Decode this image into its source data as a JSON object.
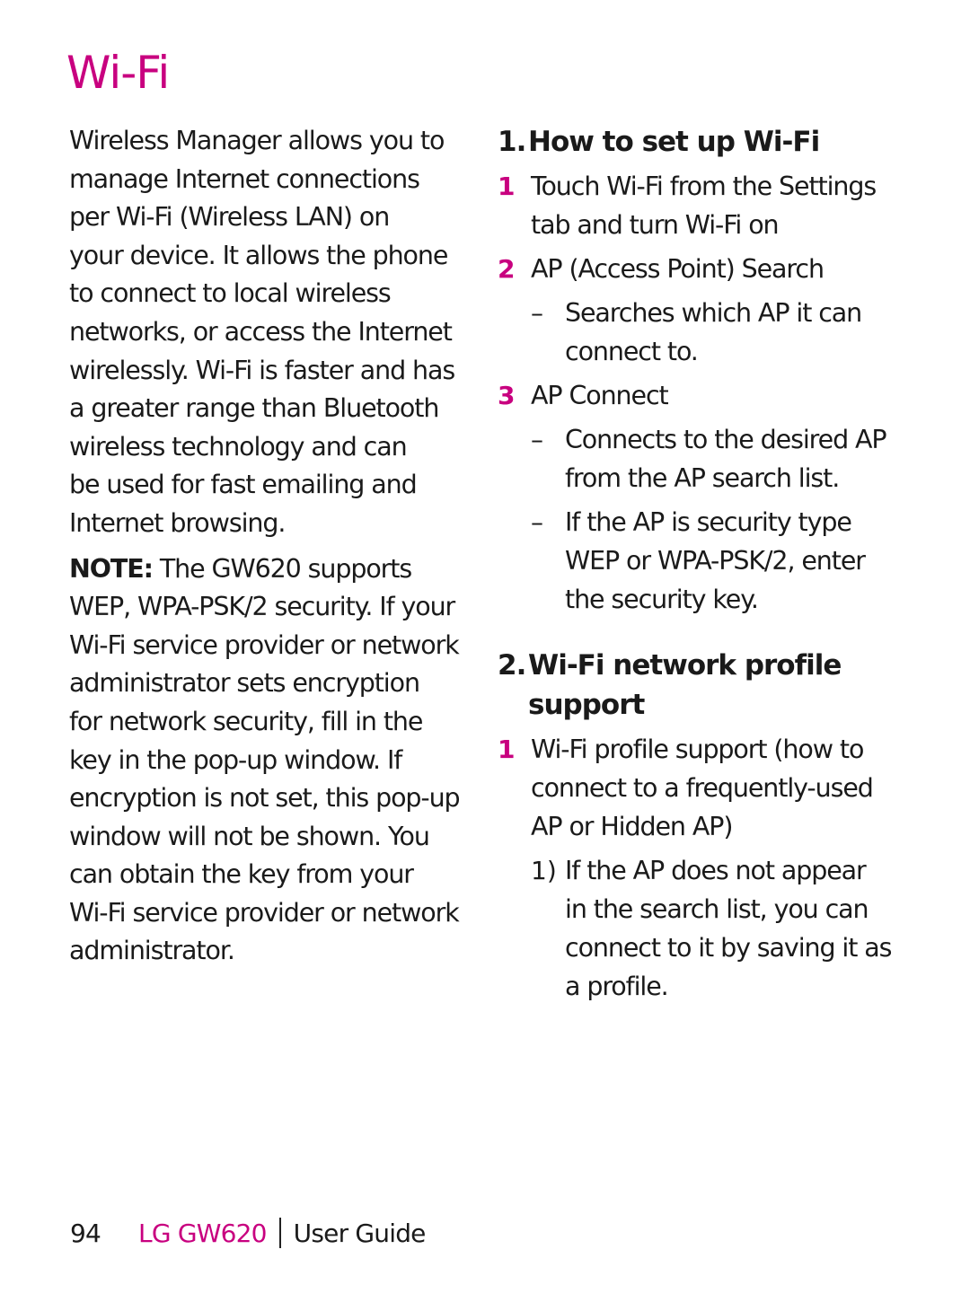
{
  "page": {
    "title": "Wi-Fi",
    "accent_color": "#c8007f"
  },
  "left_column": {
    "intro_lines": [
      "Wireless Manager allows you to",
      "manage Internet connections",
      "per Wi-Fi (Wireless LAN) on",
      "your device. It allows the phone",
      "to connect to local wireless",
      "networks, or access the Internet",
      "wirelessly. Wi-Fi is faster and has",
      "a greater range than Bluetooth",
      "wireless technology and can",
      "be used for fast emailing and",
      "Internet browsing."
    ],
    "note_label": "NOTE:",
    "note_first_line": " The GW620 supports",
    "note_lines": [
      "WEP, WPA-PSK/2 security. If your",
      "Wi-Fi service provider or network",
      "administrator sets encryption",
      "for network security, fill in the",
      "key in the pop-up window. If",
      "encryption is not set, this pop-up",
      "window will not be shown. You",
      "can obtain the key from your",
      "Wi-Fi service provider or network",
      "administrator."
    ]
  },
  "right_column": {
    "section1": {
      "number": "1.",
      "heading": "How to set up Wi-Fi",
      "steps": [
        {
          "num": "1",
          "lines": [
            "Touch Wi-Fi from the Settings",
            "tab and turn Wi-Fi on"
          ]
        },
        {
          "num": "2",
          "lines": [
            "AP (Access Point) Search"
          ],
          "subs": [
            {
              "marker": "–",
              "lines": [
                "Searches which AP it can",
                "connect to."
              ]
            }
          ]
        },
        {
          "num": "3",
          "lines": [
            "AP Connect"
          ],
          "subs": [
            {
              "marker": "–",
              "lines": [
                "Connects to the desired AP",
                "from the AP search list."
              ]
            },
            {
              "marker": "–",
              "lines": [
                "If the AP is security type",
                "WEP or WPA-PSK/2, enter",
                "the security key."
              ]
            }
          ]
        }
      ]
    },
    "section2": {
      "number": "2.",
      "heading_line1": "Wi-Fi network profile",
      "heading_line2": "support",
      "steps": [
        {
          "num": "1",
          "lines": [
            "Wi-Fi profile support (how to",
            "connect to a frequently-used",
            "AP or Hidden AP)"
          ],
          "subs": [
            {
              "marker": "1)",
              "lines": [
                "If the AP does not appear",
                "in the search list, you can",
                "connect to it by saving it as",
                "a profile."
              ]
            }
          ]
        }
      ]
    }
  },
  "footer": {
    "page_number": "94",
    "brand": "LG GW620",
    "guide": "User Guide"
  }
}
